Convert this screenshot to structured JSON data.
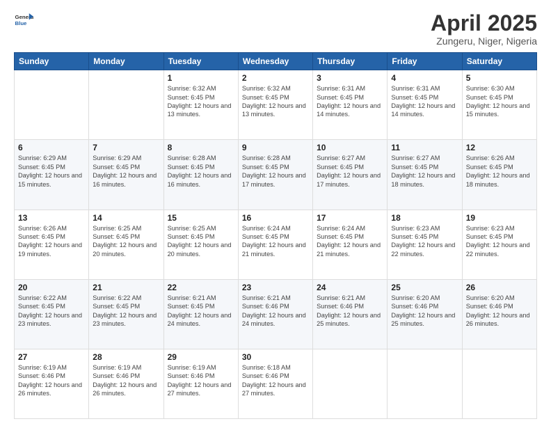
{
  "logo": {
    "line1": "General",
    "line2": "Blue"
  },
  "title": "April 2025",
  "location": "Zungeru, Niger, Nigeria",
  "days_of_week": [
    "Sunday",
    "Monday",
    "Tuesday",
    "Wednesday",
    "Thursday",
    "Friday",
    "Saturday"
  ],
  "weeks": [
    [
      {
        "day": "",
        "sunrise": "",
        "sunset": "",
        "daylight": ""
      },
      {
        "day": "",
        "sunrise": "",
        "sunset": "",
        "daylight": ""
      },
      {
        "day": "1",
        "sunrise": "Sunrise: 6:32 AM",
        "sunset": "Sunset: 6:45 PM",
        "daylight": "Daylight: 12 hours and 13 minutes."
      },
      {
        "day": "2",
        "sunrise": "Sunrise: 6:32 AM",
        "sunset": "Sunset: 6:45 PM",
        "daylight": "Daylight: 12 hours and 13 minutes."
      },
      {
        "day": "3",
        "sunrise": "Sunrise: 6:31 AM",
        "sunset": "Sunset: 6:45 PM",
        "daylight": "Daylight: 12 hours and 14 minutes."
      },
      {
        "day": "4",
        "sunrise": "Sunrise: 6:31 AM",
        "sunset": "Sunset: 6:45 PM",
        "daylight": "Daylight: 12 hours and 14 minutes."
      },
      {
        "day": "5",
        "sunrise": "Sunrise: 6:30 AM",
        "sunset": "Sunset: 6:45 PM",
        "daylight": "Daylight: 12 hours and 15 minutes."
      }
    ],
    [
      {
        "day": "6",
        "sunrise": "Sunrise: 6:29 AM",
        "sunset": "Sunset: 6:45 PM",
        "daylight": "Daylight: 12 hours and 15 minutes."
      },
      {
        "day": "7",
        "sunrise": "Sunrise: 6:29 AM",
        "sunset": "Sunset: 6:45 PM",
        "daylight": "Daylight: 12 hours and 16 minutes."
      },
      {
        "day": "8",
        "sunrise": "Sunrise: 6:28 AM",
        "sunset": "Sunset: 6:45 PM",
        "daylight": "Daylight: 12 hours and 16 minutes."
      },
      {
        "day": "9",
        "sunrise": "Sunrise: 6:28 AM",
        "sunset": "Sunset: 6:45 PM",
        "daylight": "Daylight: 12 hours and 17 minutes."
      },
      {
        "day": "10",
        "sunrise": "Sunrise: 6:27 AM",
        "sunset": "Sunset: 6:45 PM",
        "daylight": "Daylight: 12 hours and 17 minutes."
      },
      {
        "day": "11",
        "sunrise": "Sunrise: 6:27 AM",
        "sunset": "Sunset: 6:45 PM",
        "daylight": "Daylight: 12 hours and 18 minutes."
      },
      {
        "day": "12",
        "sunrise": "Sunrise: 6:26 AM",
        "sunset": "Sunset: 6:45 PM",
        "daylight": "Daylight: 12 hours and 18 minutes."
      }
    ],
    [
      {
        "day": "13",
        "sunrise": "Sunrise: 6:26 AM",
        "sunset": "Sunset: 6:45 PM",
        "daylight": "Daylight: 12 hours and 19 minutes."
      },
      {
        "day": "14",
        "sunrise": "Sunrise: 6:25 AM",
        "sunset": "Sunset: 6:45 PM",
        "daylight": "Daylight: 12 hours and 20 minutes."
      },
      {
        "day": "15",
        "sunrise": "Sunrise: 6:25 AM",
        "sunset": "Sunset: 6:45 PM",
        "daylight": "Daylight: 12 hours and 20 minutes."
      },
      {
        "day": "16",
        "sunrise": "Sunrise: 6:24 AM",
        "sunset": "Sunset: 6:45 PM",
        "daylight": "Daylight: 12 hours and 21 minutes."
      },
      {
        "day": "17",
        "sunrise": "Sunrise: 6:24 AM",
        "sunset": "Sunset: 6:45 PM",
        "daylight": "Daylight: 12 hours and 21 minutes."
      },
      {
        "day": "18",
        "sunrise": "Sunrise: 6:23 AM",
        "sunset": "Sunset: 6:45 PM",
        "daylight": "Daylight: 12 hours and 22 minutes."
      },
      {
        "day": "19",
        "sunrise": "Sunrise: 6:23 AM",
        "sunset": "Sunset: 6:45 PM",
        "daylight": "Daylight: 12 hours and 22 minutes."
      }
    ],
    [
      {
        "day": "20",
        "sunrise": "Sunrise: 6:22 AM",
        "sunset": "Sunset: 6:45 PM",
        "daylight": "Daylight: 12 hours and 23 minutes."
      },
      {
        "day": "21",
        "sunrise": "Sunrise: 6:22 AM",
        "sunset": "Sunset: 6:45 PM",
        "daylight": "Daylight: 12 hours and 23 minutes."
      },
      {
        "day": "22",
        "sunrise": "Sunrise: 6:21 AM",
        "sunset": "Sunset: 6:45 PM",
        "daylight": "Daylight: 12 hours and 24 minutes."
      },
      {
        "day": "23",
        "sunrise": "Sunrise: 6:21 AM",
        "sunset": "Sunset: 6:46 PM",
        "daylight": "Daylight: 12 hours and 24 minutes."
      },
      {
        "day": "24",
        "sunrise": "Sunrise: 6:21 AM",
        "sunset": "Sunset: 6:46 PM",
        "daylight": "Daylight: 12 hours and 25 minutes."
      },
      {
        "day": "25",
        "sunrise": "Sunrise: 6:20 AM",
        "sunset": "Sunset: 6:46 PM",
        "daylight": "Daylight: 12 hours and 25 minutes."
      },
      {
        "day": "26",
        "sunrise": "Sunrise: 6:20 AM",
        "sunset": "Sunset: 6:46 PM",
        "daylight": "Daylight: 12 hours and 26 minutes."
      }
    ],
    [
      {
        "day": "27",
        "sunrise": "Sunrise: 6:19 AM",
        "sunset": "Sunset: 6:46 PM",
        "daylight": "Daylight: 12 hours and 26 minutes."
      },
      {
        "day": "28",
        "sunrise": "Sunrise: 6:19 AM",
        "sunset": "Sunset: 6:46 PM",
        "daylight": "Daylight: 12 hours and 26 minutes."
      },
      {
        "day": "29",
        "sunrise": "Sunrise: 6:19 AM",
        "sunset": "Sunset: 6:46 PM",
        "daylight": "Daylight: 12 hours and 27 minutes."
      },
      {
        "day": "30",
        "sunrise": "Sunrise: 6:18 AM",
        "sunset": "Sunset: 6:46 PM",
        "daylight": "Daylight: 12 hours and 27 minutes."
      },
      {
        "day": "",
        "sunrise": "",
        "sunset": "",
        "daylight": ""
      },
      {
        "day": "",
        "sunrise": "",
        "sunset": "",
        "daylight": ""
      },
      {
        "day": "",
        "sunrise": "",
        "sunset": "",
        "daylight": ""
      }
    ]
  ]
}
